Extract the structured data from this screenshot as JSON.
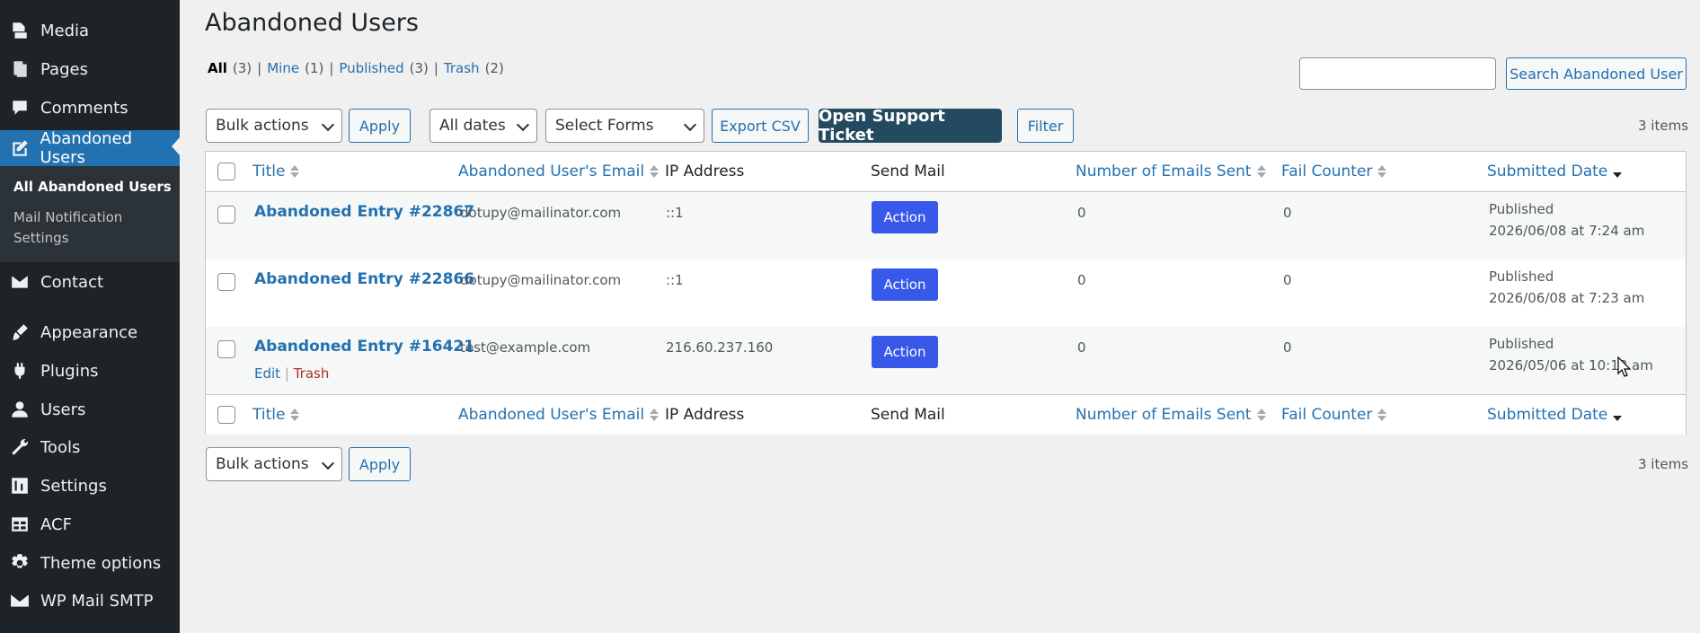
{
  "sidebar": {
    "items": [
      {
        "label": "Media",
        "icon": "media-icon"
      },
      {
        "label": "Pages",
        "icon": "pages-icon"
      },
      {
        "label": "Comments",
        "icon": "comments-icon"
      },
      {
        "label": "Abandoned Users",
        "icon": "edit-icon"
      },
      {
        "label": "Contact",
        "icon": "mail-icon"
      },
      {
        "label": "Appearance",
        "icon": "brush-icon"
      },
      {
        "label": "Plugins",
        "icon": "plugin-icon"
      },
      {
        "label": "Users",
        "icon": "user-icon"
      },
      {
        "label": "Tools",
        "icon": "wrench-icon"
      },
      {
        "label": "Settings",
        "icon": "settings-icon"
      },
      {
        "label": "ACF",
        "icon": "table-icon"
      },
      {
        "label": "Theme options",
        "icon": "gear-icon"
      },
      {
        "label": "WP Mail SMTP",
        "icon": "envelope-icon"
      }
    ],
    "submenu": [
      {
        "label": "All Abandoned Users"
      },
      {
        "label": "Mail Notification"
      },
      {
        "label": "Settings"
      }
    ]
  },
  "page": {
    "title": "Abandoned Users",
    "filters": [
      {
        "label": "All",
        "count": "(3)"
      },
      {
        "label": "Mine",
        "count": "(1)"
      },
      {
        "label": "Published",
        "count": "(3)"
      },
      {
        "label": "Trash",
        "count": "(2)"
      }
    ],
    "separator": "|",
    "search_button": "Search Abandoned User",
    "search_placeholder": "",
    "bulk_actions": "Bulk actions",
    "apply": "Apply",
    "all_dates": "All dates",
    "select_forms": "Select Forms",
    "export_csv": "Export CSV",
    "open_ticket": "Open Support Ticket",
    "filter": "Filter",
    "items_count": "3 items"
  },
  "table": {
    "columns": [
      "Title",
      "Abandoned User's Email",
      "IP Address",
      "Send Mail",
      "Number of Emails Sent",
      "Fail Counter",
      "Submitted Date"
    ],
    "rows": [
      {
        "title": "Abandoned Entry #22867",
        "email": "dotupy@mailinator.com",
        "ip": "::1",
        "action": "Action",
        "emails_sent": "0",
        "fail": "0",
        "status": "Published",
        "date": "2026/06/08 at 7:24 am"
      },
      {
        "title": "Abandoned Entry #22866",
        "email": "dotupy@mailinator.com",
        "ip": "::1",
        "action": "Action",
        "emails_sent": "0",
        "fail": "0",
        "status": "Published",
        "date": "2026/06/08 at 7:23 am"
      },
      {
        "title": "Abandoned Entry #16421",
        "email": "test@example.com",
        "ip": "216.60.237.160",
        "action": "Action",
        "emails_sent": "0",
        "fail": "0",
        "status": "Published",
        "date": "2026/05/06 at 10:13 am"
      }
    ],
    "row_actions": {
      "edit": "Edit",
      "trash": "Trash"
    }
  }
}
